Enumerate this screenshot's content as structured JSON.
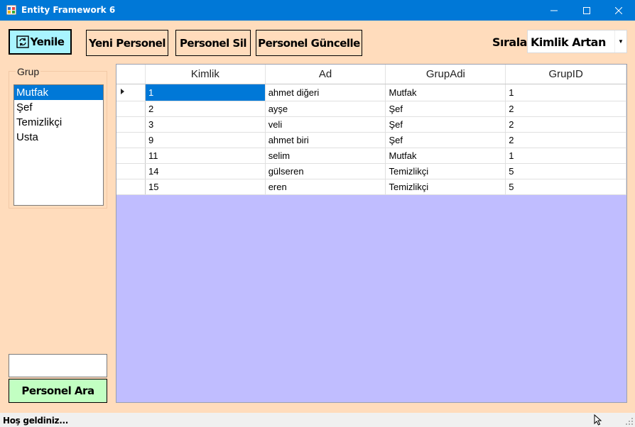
{
  "window": {
    "title": "Entity Framework 6"
  },
  "toolbar": {
    "refresh_label": "Yenile",
    "new_label": "Yeni Personel",
    "delete_label": "Personel Sil",
    "update_label": "Personel Güncelle",
    "sort_label": "Sırala",
    "sort_value": "Kimlik Artan"
  },
  "group": {
    "label": "Grup",
    "items": [
      "Mutfak",
      "Şef",
      "Temizlikçi",
      "Usta"
    ],
    "selected": "Mutfak"
  },
  "search": {
    "value": "",
    "button_label": "Personel Ara"
  },
  "table": {
    "columns": [
      "Kimlik",
      "Ad",
      "GrupAdi",
      "GrupID"
    ],
    "rows": [
      [
        "1",
        "ahmet diğeri",
        "Mutfak",
        "1"
      ],
      [
        "2",
        "ayşe",
        "Şef",
        "2"
      ],
      [
        "3",
        "veli",
        "Şef",
        "2"
      ],
      [
        "9",
        "ahmet biri",
        "Şef",
        "2"
      ],
      [
        "11",
        "selim",
        "Mutfak",
        "1"
      ],
      [
        "14",
        "gülseren",
        "Temizlikçi",
        "5"
      ],
      [
        "15",
        "eren",
        "Temizlikçi",
        "5"
      ]
    ]
  },
  "status": {
    "text": "Hoş geldiniz..."
  },
  "colors": {
    "titlebar": "#0078d7",
    "form_bg": "#ffdcbc",
    "grid_bg": "#c0bdff",
    "refresh_bg": "#a9f4ff",
    "search_bg": "#c2ffc2"
  }
}
